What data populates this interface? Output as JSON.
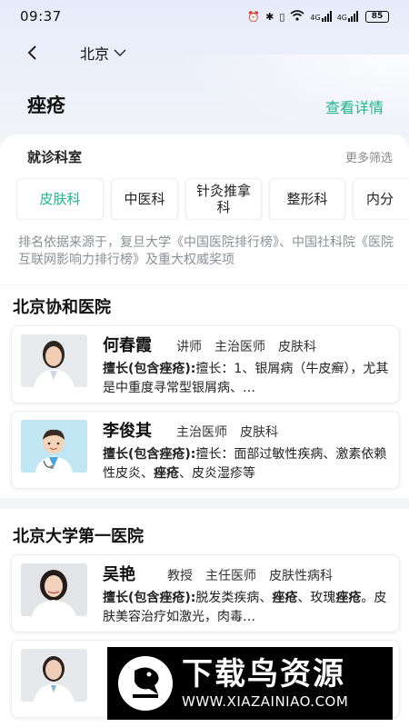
{
  "status_bar": {
    "time": "09:37",
    "network_1": "4G",
    "network_2": "4G",
    "battery": "85"
  },
  "nav": {
    "city": "北京",
    "title": "痤疮",
    "detail_link": "查看详情"
  },
  "department": {
    "title": "就诊科室",
    "more_filter": "更多筛选",
    "chips": [
      {
        "label": "皮肤科",
        "active": true
      },
      {
        "label": "中医科",
        "active": false
      },
      {
        "label": "针灸推拿科",
        "active": false
      },
      {
        "label": "整形科",
        "active": false
      },
      {
        "label": "内分",
        "active": false
      }
    ],
    "accent_color": "#20b58e"
  },
  "ranking_note": "排名依据来源于，复旦大学《中国医院排行榜》、中国社科院《医院互联网影响力排行榜》及重大权威奖项",
  "hospitals": [
    {
      "name": "北京协和医院",
      "doctors": [
        {
          "name": "何春霞",
          "titles": [
            "讲师",
            "主治医师",
            "皮肤科"
          ],
          "skill_label": "擅长(包含痤疮):",
          "skill_text": "擅长：1、银屑病（牛皮癣），尤其是中重度寻常型银屑病、…",
          "avatar": "photo-female-doctor"
        },
        {
          "name": "李俊其",
          "titles": [
            "主治医师",
            "皮肤科"
          ],
          "skill_label": "擅长(包含痤疮):",
          "skill_text_1": "擅长：面部过敏性疾病、激素依赖性皮炎、",
          "skill_bold": "痤疮",
          "skill_text_2": "、皮炎湿疹等",
          "avatar": "cartoon-male-doctor"
        }
      ]
    },
    {
      "name": "北京大学第一医院",
      "doctors": [
        {
          "name": "吴艳",
          "titles": [
            "教授",
            "主任医师",
            "皮肤性病科"
          ],
          "skill_label": "擅长(包含痤疮):",
          "skill_text_1": "脱发类疾病、",
          "skill_bold_1": "痤疮",
          "skill_text_2": "、玫瑰",
          "skill_bold_2": "痤疮",
          "skill_text_3": "。皮肤美容治疗如激光，肉毒…",
          "avatar": "photo-female-doctor"
        },
        {
          "name": "",
          "titles": [],
          "avatar": "photo-female-doctor"
        }
      ]
    }
  ],
  "watermark": {
    "title": "下载鸟资源",
    "url": "WWW.XIAZAINIAO.COM"
  }
}
